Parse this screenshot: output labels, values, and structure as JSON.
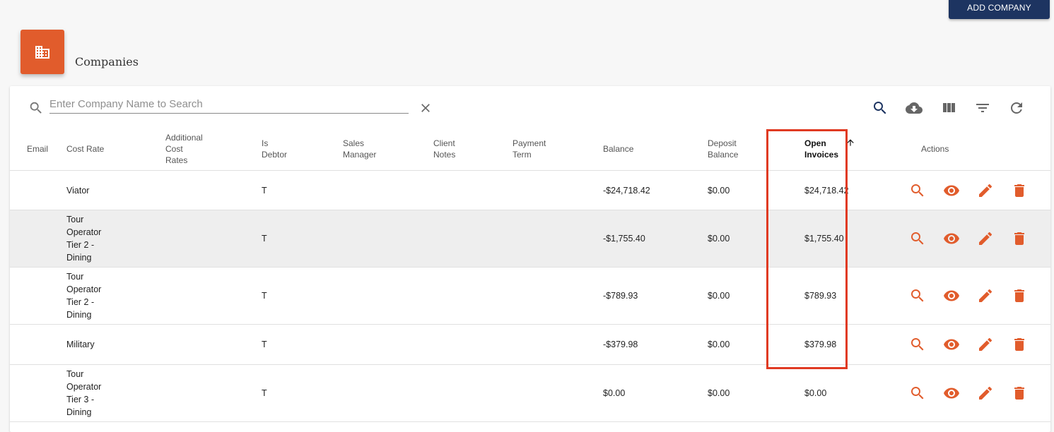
{
  "toolbar": {
    "add_company_label": "ADD COMPANY",
    "accent_color": "#e15c2c",
    "button_color": "#1d3461"
  },
  "page": {
    "title": "Companies",
    "header_icon": "building-icon"
  },
  "search": {
    "placeholder": "Enter Company Name to Search",
    "value": ""
  },
  "table_tools": [
    "search-icon",
    "cloud-download-icon",
    "view-columns-icon",
    "filter-icon",
    "refresh-icon"
  ],
  "columns": [
    {
      "key": "email",
      "label": "Email"
    },
    {
      "key": "cost_rate",
      "label": "Cost Rate"
    },
    {
      "key": "additional_cost_rates",
      "label": "Additional\nCost\nRates"
    },
    {
      "key": "is_debtor",
      "label": "Is\nDebtor"
    },
    {
      "key": "sales_manager",
      "label": "Sales\nManager"
    },
    {
      "key": "client_notes",
      "label": "Client\nNotes"
    },
    {
      "key": "payment_term",
      "label": "Payment\nTerm"
    },
    {
      "key": "balance",
      "label": "Balance"
    },
    {
      "key": "deposit_balance",
      "label": "Deposit\nBalance"
    },
    {
      "key": "open_invoices",
      "label": "Open\nInvoices",
      "sorted": "asc"
    },
    {
      "key": "actions",
      "label": "Actions"
    }
  ],
  "rows": [
    {
      "email": "",
      "cost_rate": "Viator",
      "additional_cost_rates": "",
      "is_debtor": "T",
      "sales_manager": "",
      "client_notes": "",
      "payment_term": "",
      "balance": "-$24,718.42",
      "deposit_balance": "$0.00",
      "open_invoices": "$24,718.42"
    },
    {
      "email": "",
      "cost_rate": "Tour\nOperator\nTier 2 -\nDining",
      "additional_cost_rates": "",
      "is_debtor": "T",
      "sales_manager": "",
      "client_notes": "",
      "payment_term": "",
      "balance": "-$1,755.40",
      "deposit_balance": "$0.00",
      "open_invoices": "$1,755.40",
      "highlighted": true
    },
    {
      "email": "",
      "cost_rate": "Tour\nOperator\nTier 2 -\nDining",
      "additional_cost_rates": "",
      "is_debtor": "T",
      "sales_manager": "",
      "client_notes": "",
      "payment_term": "",
      "balance": "-$789.93",
      "deposit_balance": "$0.00",
      "open_invoices": "$789.93"
    },
    {
      "email": "",
      "cost_rate": "Military",
      "additional_cost_rates": "",
      "is_debtor": "T",
      "sales_manager": "",
      "client_notes": "",
      "payment_term": "",
      "balance": "-$379.98",
      "deposit_balance": "$0.00",
      "open_invoices": "$379.98"
    },
    {
      "email": "",
      "cost_rate": "Tour\nOperator\nTier 3 -\nDining",
      "additional_cost_rates": "",
      "is_debtor": "T",
      "sales_manager": "",
      "client_notes": "",
      "payment_term": "",
      "balance": "$0.00",
      "deposit_balance": "$0.00",
      "open_invoices": "$0.00"
    }
  ],
  "row_actions": [
    "search-icon",
    "view-icon",
    "edit-icon",
    "delete-icon"
  ]
}
